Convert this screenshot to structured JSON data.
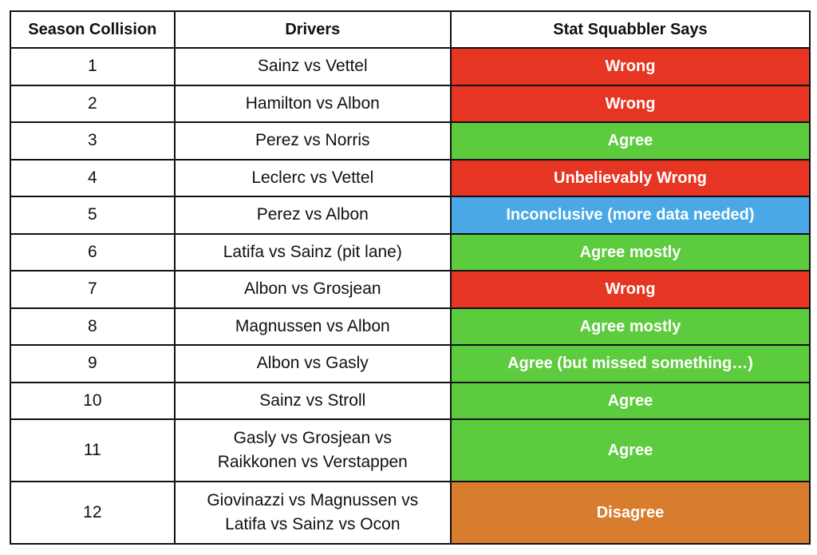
{
  "table": {
    "headers": [
      "Season Collision",
      "Drivers",
      "Stat Squabbler Says"
    ],
    "colors": {
      "red": "#E63523",
      "green": "#5DCB3E",
      "blue": "#4AA8E6",
      "orange": "#D87C2E"
    },
    "rows": [
      {
        "collision": "1",
        "drivers": "Sainz vs Vettel",
        "verdict": "Wrong",
        "color": "red"
      },
      {
        "collision": "2",
        "drivers": "Hamilton vs Albon",
        "verdict": "Wrong",
        "color": "red"
      },
      {
        "collision": "3",
        "drivers": "Perez vs Norris",
        "verdict": "Agree",
        "color": "green"
      },
      {
        "collision": "4",
        "drivers": "Leclerc vs Vettel",
        "verdict": "Unbelievably Wrong",
        "color": "red"
      },
      {
        "collision": "5",
        "drivers": "Perez vs Albon",
        "verdict": "Inconclusive (more data needed)",
        "color": "blue"
      },
      {
        "collision": "6",
        "drivers": "Latifa vs Sainz (pit lane)",
        "verdict": "Agree mostly",
        "color": "green"
      },
      {
        "collision": "7",
        "drivers": "Albon vs Grosjean",
        "verdict": "Wrong",
        "color": "red"
      },
      {
        "collision": "8",
        "drivers": "Magnussen vs Albon",
        "verdict": "Agree mostly",
        "color": "green"
      },
      {
        "collision": "9",
        "drivers": "Albon vs Gasly",
        "verdict": "Agree (but missed something…)",
        "color": "green"
      },
      {
        "collision": "10",
        "drivers": "Sainz vs Stroll",
        "verdict": "Agree",
        "color": "green"
      },
      {
        "collision": "11",
        "drivers_lines": [
          "Gasly vs Grosjean vs",
          "Raikkonen vs Verstappen"
        ],
        "verdict": "Agree",
        "color": "green"
      },
      {
        "collision": "12",
        "drivers_lines": [
          "Giovinazzi vs Magnussen vs",
          "Latifa vs Sainz vs Ocon"
        ],
        "verdict": "Disagree",
        "color": "orange"
      }
    ]
  }
}
